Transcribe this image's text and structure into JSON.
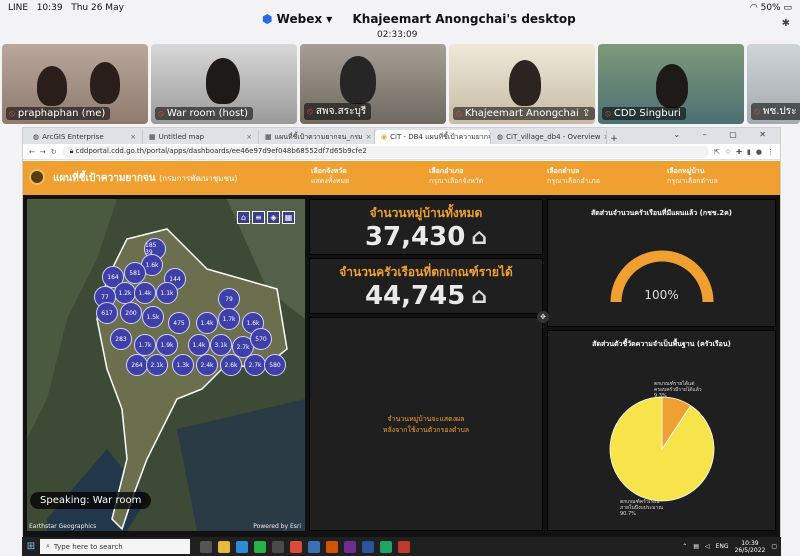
{
  "ios_status": {
    "carrier": "LINE",
    "time": "10:39",
    "date": "Thu 26 May",
    "battery": "50%"
  },
  "webex": {
    "brand": "Webex",
    "share_title": "Khajeemart Anongchai's desktop",
    "timer": "02:33:09"
  },
  "participants": [
    {
      "name": "praphaphan (me)"
    },
    {
      "name": "War room (host)"
    },
    {
      "name": "สพจ.สระบุรี"
    },
    {
      "name": "Khajeemart Anongchai"
    },
    {
      "name": "CDD Singburi"
    },
    {
      "name": "พช.ประ"
    }
  ],
  "browser": {
    "tabs": [
      {
        "label": "ArcGIS Enterprise"
      },
      {
        "label": "Untitled map"
      },
      {
        "label": "แผนที่ชี้เป้าความยากจน_กรม"
      },
      {
        "label": "CiT - DB4 แผนที่ชี้เป้าความยากจน"
      },
      {
        "label": "CiT_village_db4 - Overview"
      }
    ],
    "url": "cddportal.cdd.go.th/portal/apps/dashboards/ee46e97d9ef048b68552df7d65b9cfe2"
  },
  "dashboard": {
    "title": "แผนที่ชี้เป้าความยากจน",
    "subtitle": "(กรมการพัฒนาชุมชน)",
    "filters": [
      {
        "label": "เลือกจังหวัด",
        "value": "แสดงทั้งหมด"
      },
      {
        "label": "เลือกอำเภอ",
        "value": "กรุณาเลือกจังหวัด"
      },
      {
        "label": "เลือกตำบล",
        "value": "กรุณาเลือกอำเภอ"
      },
      {
        "label": "เลือกหมู่บ้าน",
        "value": "กรุณาเลือกตำบล"
      }
    ],
    "map": {
      "clusters": [
        "185 39",
        "1.6k",
        "581",
        "144",
        "164",
        "1.2k",
        "1.4k",
        "77",
        "1.1k",
        "200",
        "617",
        "1.5k",
        "79",
        "475",
        "1.4k",
        "1.7k",
        "1.6k",
        "283",
        "1.7k",
        "1.9k",
        "1.4k",
        "3.1k",
        "2.7k",
        "570",
        "264",
        "2.1k",
        "1.3k",
        "2.4k",
        "2.6k",
        "2.7k",
        "580"
      ],
      "speaking": "Speaking: War room",
      "attribution": "Earthstar Geographics",
      "powered": "Powered by Esri"
    },
    "kpi_villages": {
      "title": "จำนวนหมู่บ้านทั้งหมด",
      "value": "37,430"
    },
    "kpi_households": {
      "title": "จำนวนครัวเรือนที่ตกเกณฑ์รายได้",
      "value": "44,745"
    },
    "center_message_line1": "จำนวนหมู่บ้านจะแสดงผล",
    "center_message_line2": "หลังจากใช้งานตัวกรองตำบล",
    "gauge": {
      "title": "สัดส่วนจำนวนครัวเรือนที่มีแผนแล้ว (กชช.2ค)",
      "value_text": "100%",
      "value": 100
    },
    "pie": {
      "title": "สัดส่วนตัวชี้วัดความจำเป็นพื้นฐาน (ครัวเรือน)",
      "label_small_1": "ตกเกณฑ์รายได้แต่",
      "label_small_2": "ครอบครัวมีรายได้แล้ว",
      "label_small_pct": "9.3%",
      "label_large_1": "ตกเกณฑ์ครัวเรือน",
      "label_large_2": "ภายในปีงบประมาณ",
      "label_large_pct": "90.7%"
    }
  },
  "chart_data": {
    "type": "pie",
    "title": "สัดส่วนตัวชี้วัดความจำเป็นพื้นฐาน (ครัวเรือน)",
    "slices": [
      {
        "value": 9.3,
        "color": "#f0a030"
      },
      {
        "value": 90.7,
        "color": "#f7e34a"
      }
    ]
  },
  "taskbar": {
    "search_placeholder": "Type here to search",
    "lang": "ENG",
    "time": "10:39",
    "date": "26/5/2022"
  },
  "colors": {
    "accent": "#f0a030",
    "panel": "#1f1f1f",
    "cluster": "#3f3fa8",
    "pie_large": "#f7e34a"
  }
}
